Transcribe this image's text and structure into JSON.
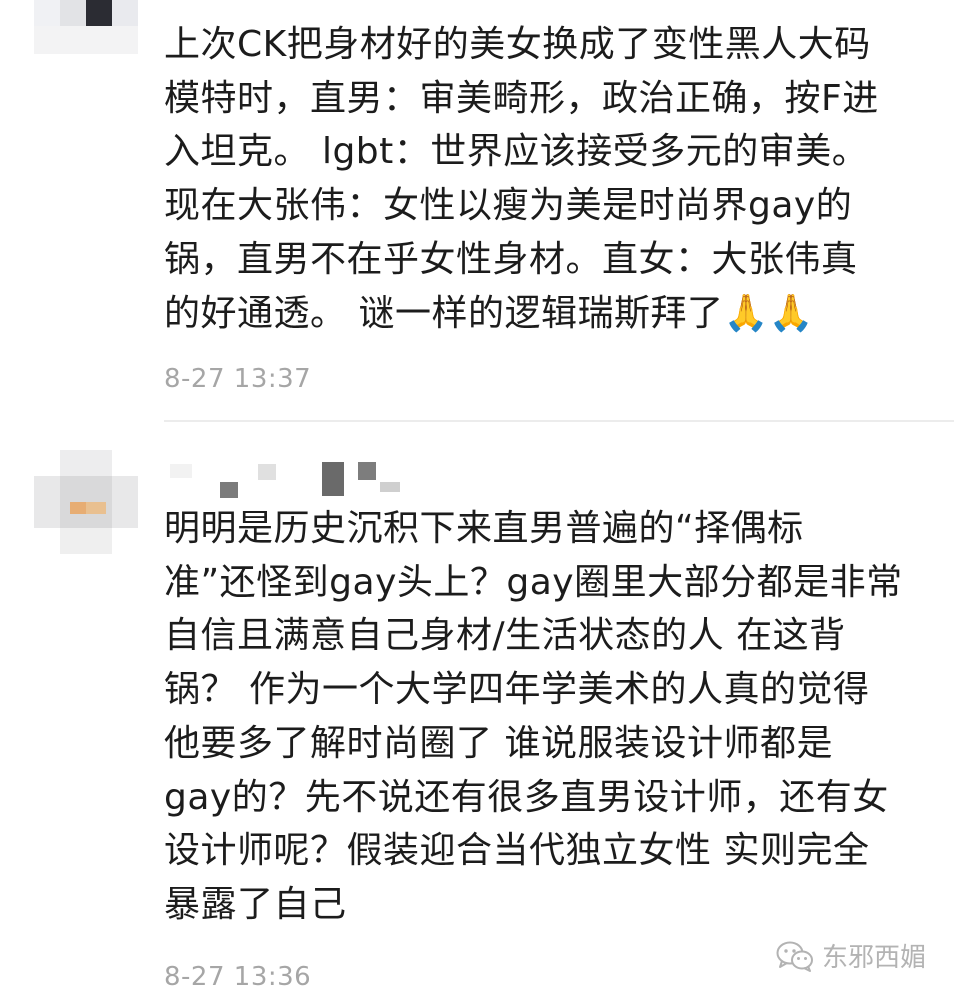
{
  "comments": [
    {
      "text_lines": [
        "上次CK把身材好的美女换成了变性黑人大码",
        "模特时，直男：审美畸形，政治正确，按F进",
        "入坦克。 lgbt：世界应该接受多元的审美。",
        "现在大张伟：女性以瘦为美是时尚界gay的",
        "锅，直男不在乎女性身材。直女：大张伟真",
        "的好通透。 谜一样的逻辑瑞斯拜了🙏🙏"
      ],
      "timestamp": "8-27 13:37"
    },
    {
      "text_lines": [
        "明明是历史沉积下来直男普遍的“择偶标",
        "准”还怪到gay头上？gay圈里大部分都是非常",
        "自信且满意自己身材/生活状态的人 在这背",
        "锅？ 作为一个大学四年学美术的人真的觉得",
        "他要多了解时尚圈了 谁说服装设计师都是",
        "gay的？先不说还有很多直男设计师，还有女",
        "设计师呢？假装迎合当代独立女性 实则完全",
        "暴露了自己"
      ],
      "timestamp": "8-27 13:36"
    }
  ],
  "watermark": {
    "icon": "wechat-icon",
    "label": "东邪西媚"
  }
}
